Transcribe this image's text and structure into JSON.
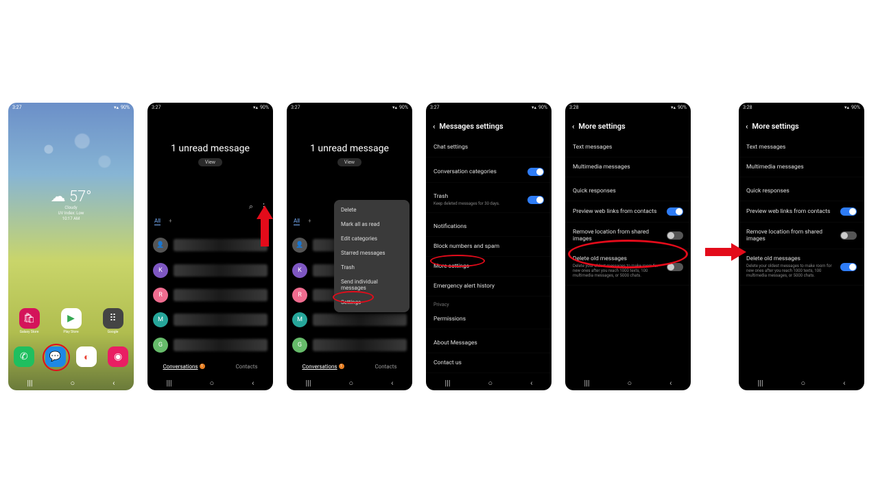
{
  "status": {
    "time_327": "3:27",
    "time_328": "3:28",
    "battery": "90%",
    "signal_icons": "▾ ▴ ▮"
  },
  "home": {
    "temp": "57°",
    "cloud_icon": "☁",
    "city": "Cloudy",
    "uv": "UV Index: Low",
    "clock": "10:17 AM",
    "apps_row": [
      {
        "name": "Galaxy Store",
        "bg": "#d4145a",
        "glyph": "🛍"
      },
      {
        "name": "Play Store",
        "bg": "#ffffff",
        "glyph": "▶"
      },
      {
        "name": "Google",
        "bg": "#3a3a3a",
        "glyph": "⠿"
      }
    ],
    "dock": [
      {
        "name": "Phone",
        "bg": "#1fbf5f",
        "glyph": "✆"
      },
      {
        "name": "Messages",
        "bg": "#1e88e5",
        "glyph": "💬"
      },
      {
        "name": "Chrome",
        "bg": "#ffffff",
        "glyph": "◐"
      },
      {
        "name": "Camera",
        "bg": "#e91e63",
        "glyph": "◉"
      }
    ]
  },
  "messages": {
    "headline": "1 unread message",
    "view": "View",
    "tab_all": "All",
    "tab_plus": "+",
    "bottom_conversations": "Conversations",
    "bottom_contacts": "Contacts",
    "badge": "1",
    "avatars": [
      {
        "letter": "",
        "bg": "#555"
      },
      {
        "letter": "K",
        "bg": "#7e57c2"
      },
      {
        "letter": "R",
        "bg": "#ef6c8f"
      },
      {
        "letter": "M",
        "bg": "#26a69a"
      },
      {
        "letter": "G",
        "bg": "#66bb6a"
      }
    ]
  },
  "ctx": {
    "items": [
      "Delete",
      "Mark all as read",
      "Edit categories",
      "Starred messages",
      "Trash",
      "Send individual messages",
      "Settings"
    ]
  },
  "msg_settings": {
    "title": "Messages settings",
    "rows": {
      "chat": "Chat settings",
      "catego": "Conversation categories",
      "trash": "Trash",
      "trash_sub": "Keep deleted messages for 30 days.",
      "notif": "Notifications",
      "block": "Block numbers and spam",
      "more": "More settings",
      "emerg": "Emergency alert history",
      "privacy": "Privacy",
      "perm": "Permissions",
      "about": "About Messages",
      "contact": "Contact us"
    }
  },
  "more_settings": {
    "title": "More settings",
    "text_msgs": "Text messages",
    "mms": "Multimedia messages",
    "quick": "Quick responses",
    "preview": "Preview web links from contacts",
    "remove_loc": "Remove location from shared images",
    "delete_old": "Delete old messages",
    "delete_old_sub": "Delete your oldest messages to make room for new ones after you reach 1000 texts, 100 multimedia messages, or 5000 chats."
  },
  "nav": {
    "recents": "|||",
    "home": "○",
    "back": "‹"
  }
}
